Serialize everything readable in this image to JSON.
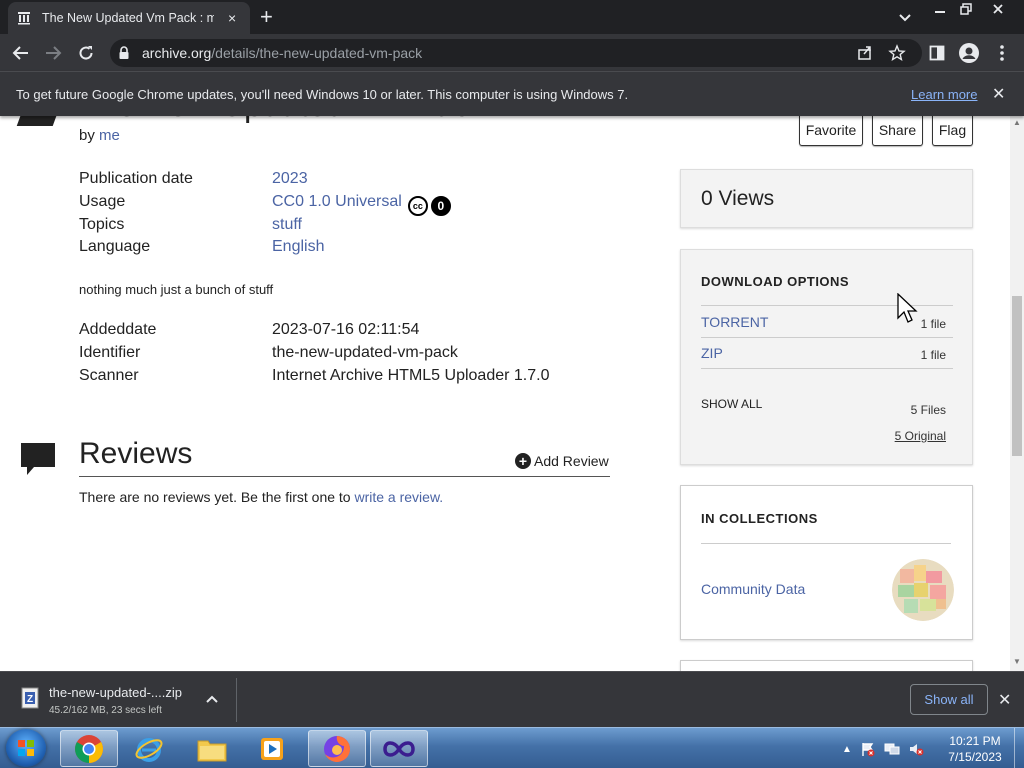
{
  "browser": {
    "tab_title": "The New Updated Vm Pack : me : F",
    "tab_close": "×",
    "new_tab": "+",
    "url_domain": "archive.org",
    "url_path": "/details/the-new-updated-vm-pack"
  },
  "infobar": {
    "message": "To get future Google Chrome updates, you'll need Windows 10 or later. This computer is using Windows 7.",
    "link": "Learn more",
    "close": "✕"
  },
  "item": {
    "title": "The New Updated Vm Pack",
    "by_label": "by",
    "creator": "me",
    "buttons": {
      "favorite": "Favorite",
      "share": "Share",
      "flag": "Flag"
    },
    "meta": [
      {
        "key": "Publication date",
        "value": "2023"
      },
      {
        "key": "Usage",
        "value": "CC0 1.0 Universal"
      },
      {
        "key": "Topics",
        "value": "stuff"
      },
      {
        "key": "Language",
        "value": "English"
      }
    ],
    "cc_badge": "cc",
    "cc_zero": "0",
    "description": "nothing much just a bunch of stuff",
    "meta2": [
      {
        "key": "Addeddate",
        "value": "2023-07-16 02:11:54"
      },
      {
        "key": "Identifier",
        "value": "the-new-updated-vm-pack"
      },
      {
        "key": "Scanner",
        "value": "Internet Archive HTML5 Uploader 1.7.0"
      }
    ]
  },
  "reviews": {
    "heading": "Reviews",
    "add": "Add Review",
    "plus": "+",
    "empty_text": "There are no reviews yet. Be the first one to",
    "empty_link": "write a review."
  },
  "sidebar": {
    "views": "0 Views",
    "download_heading": "DOWNLOAD OPTIONS",
    "downloads": [
      {
        "name": "TORRENT",
        "count": "1 file"
      },
      {
        "name": "ZIP",
        "count": "1 file"
      }
    ],
    "show_all": "SHOW ALL",
    "files": "5 Files",
    "original": "5 Original",
    "collections_heading": "IN COLLECTIONS",
    "collection": "Community Data"
  },
  "download_shelf": {
    "file_name": "the-new-updated-....zip",
    "status": "45.2/162 MB, 23 secs left",
    "show_all": "Show all",
    "close": "✕"
  },
  "taskbar": {
    "time": "10:21 PM",
    "date": "7/15/2023"
  },
  "colors": {
    "chrome_dark": "#202124",
    "chrome_toolbar": "#35363a",
    "link": "#4b64a4",
    "chrome_link": "#8ab4f8"
  }
}
